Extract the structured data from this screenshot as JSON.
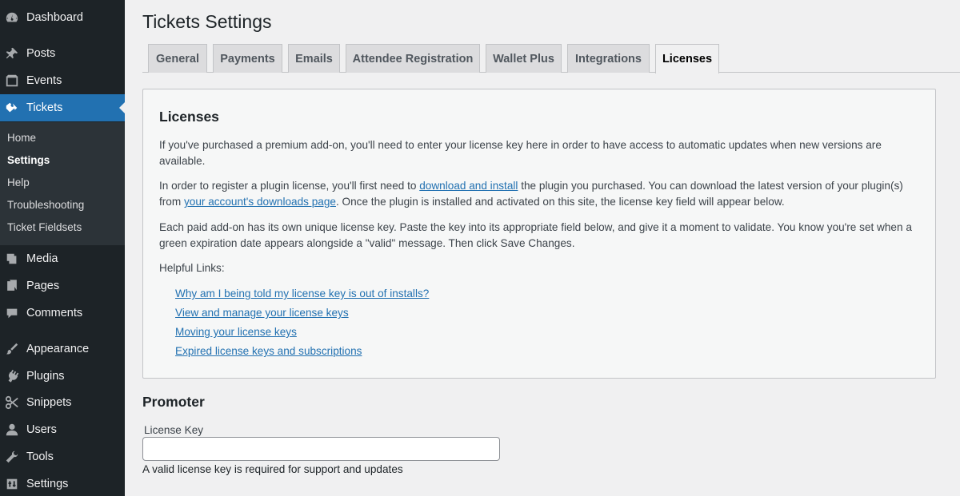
{
  "sidebar": {
    "items": [
      {
        "id": "dashboard",
        "label": "Dashboard",
        "icon": "dashboard-icon"
      },
      {
        "id": "posts",
        "label": "Posts",
        "icon": "pushpin-icon"
      },
      {
        "id": "events",
        "label": "Events",
        "icon": "calendar-icon"
      },
      {
        "id": "tickets",
        "label": "Tickets",
        "icon": "ticket-icon"
      },
      {
        "id": "media",
        "label": "Media",
        "icon": "media-icon"
      },
      {
        "id": "pages",
        "label": "Pages",
        "icon": "pages-icon"
      },
      {
        "id": "comments",
        "label": "Comments",
        "icon": "comments-icon"
      },
      {
        "id": "appearance",
        "label": "Appearance",
        "icon": "paintbrush-icon"
      },
      {
        "id": "plugins",
        "label": "Plugins",
        "icon": "plugin-icon"
      },
      {
        "id": "snippets",
        "label": "Snippets",
        "icon": "scissors-icon"
      },
      {
        "id": "users",
        "label": "Users",
        "icon": "user-icon"
      },
      {
        "id": "tools",
        "label": "Tools",
        "icon": "wrench-icon"
      },
      {
        "id": "settings",
        "label": "Settings",
        "icon": "settings-icon"
      }
    ],
    "submenu": [
      "Home",
      "Settings",
      "Help",
      "Troubleshooting",
      "Ticket Fieldsets"
    ],
    "active_item": "Tickets",
    "current_submenu": "Settings"
  },
  "page": {
    "title": "Tickets Settings",
    "tabs": [
      "General",
      "Payments",
      "Emails",
      "Attendee Registration",
      "Wallet Plus",
      "Integrations",
      "Licenses"
    ],
    "active_tab": "Licenses"
  },
  "licenses": {
    "heading": "Licenses",
    "p1": "If you've purchased a premium add-on, you'll need to enter your license key here in order to have access to automatic updates when new versions are available.",
    "p2_a": "In order to register a plugin license, you'll first need to ",
    "p2_link1": "download and install",
    "p2_b": " the plugin you purchased. You can download the latest version of your plugin(s) from ",
    "p2_link2": "your account's downloads page",
    "p2_c": ". Once the plugin is installed and activated on this site, the license key field will appear below.",
    "p3": "Each paid add-on has its own unique license key. Paste the key into its appropriate field below, and give it a moment to validate. You know you're set when a green expiration date appears alongside a \"valid\" message. Then click Save Changes.",
    "helpful_label": "Helpful Links:",
    "links": [
      "Why am I being told my license key is out of installs?",
      "View and manage your license keys",
      "Moving your license keys",
      "Expired license keys and subscriptions"
    ]
  },
  "promoter": {
    "heading": "Promoter",
    "field_label": "License Key",
    "value": "",
    "help": "A valid license key is required for support and updates"
  },
  "colors": {
    "sidebar_bg": "#1d2327",
    "submenu_bg": "#2c3338",
    "accent": "#2271b1",
    "page_bg": "#f0f0f1"
  }
}
